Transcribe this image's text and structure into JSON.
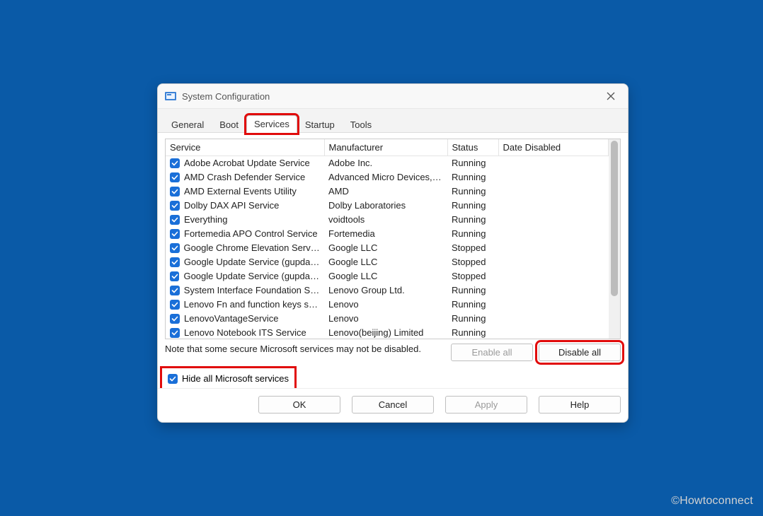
{
  "window": {
    "title": "System Configuration"
  },
  "tabs": [
    {
      "label": "General"
    },
    {
      "label": "Boot"
    },
    {
      "label": "Services"
    },
    {
      "label": "Startup"
    },
    {
      "label": "Tools"
    }
  ],
  "active_tab_index": 2,
  "columns": {
    "service": "Service",
    "manufacturer": "Manufacturer",
    "status": "Status",
    "date_disabled": "Date Disabled"
  },
  "services": [
    {
      "checked": true,
      "name": "Adobe Acrobat Update Service",
      "manufacturer": "Adobe Inc.",
      "status": "Running",
      "date_disabled": ""
    },
    {
      "checked": true,
      "name": "AMD Crash Defender Service",
      "manufacturer": "Advanced Micro Devices, I...",
      "status": "Running",
      "date_disabled": ""
    },
    {
      "checked": true,
      "name": "AMD External Events Utility",
      "manufacturer": "AMD",
      "status": "Running",
      "date_disabled": ""
    },
    {
      "checked": true,
      "name": "Dolby DAX API Service",
      "manufacturer": "Dolby Laboratories",
      "status": "Running",
      "date_disabled": ""
    },
    {
      "checked": true,
      "name": "Everything",
      "manufacturer": "voidtools",
      "status": "Running",
      "date_disabled": ""
    },
    {
      "checked": true,
      "name": "Fortemedia APO Control Service",
      "manufacturer": "Fortemedia",
      "status": "Running",
      "date_disabled": ""
    },
    {
      "checked": true,
      "name": "Google Chrome Elevation Servic...",
      "manufacturer": "Google LLC",
      "status": "Stopped",
      "date_disabled": ""
    },
    {
      "checked": true,
      "name": "Google Update Service (gupdate)",
      "manufacturer": "Google LLC",
      "status": "Stopped",
      "date_disabled": ""
    },
    {
      "checked": true,
      "name": "Google Update Service (gupdate...",
      "manufacturer": "Google LLC",
      "status": "Stopped",
      "date_disabled": ""
    },
    {
      "checked": true,
      "name": "System Interface Foundation Se...",
      "manufacturer": "Lenovo Group Ltd.",
      "status": "Running",
      "date_disabled": ""
    },
    {
      "checked": true,
      "name": "Lenovo Fn and function keys ser...",
      "manufacturer": "Lenovo",
      "status": "Running",
      "date_disabled": ""
    },
    {
      "checked": true,
      "name": "LenovoVantageService",
      "manufacturer": "Lenovo",
      "status": "Running",
      "date_disabled": ""
    },
    {
      "checked": true,
      "name": "Lenovo Notebook ITS Service",
      "manufacturer": "Lenovo(beijing) Limited",
      "status": "Running",
      "date_disabled": ""
    }
  ],
  "note": "Note that some secure Microsoft services may not be disabled.",
  "buttons": {
    "enable_all": "Enable all",
    "disable_all": "Disable all",
    "ok": "OK",
    "cancel": "Cancel",
    "apply": "Apply",
    "help": "Help"
  },
  "hide_ms": {
    "label": "Hide all Microsoft services",
    "checked": true
  },
  "watermark": "©Howtoconnect"
}
